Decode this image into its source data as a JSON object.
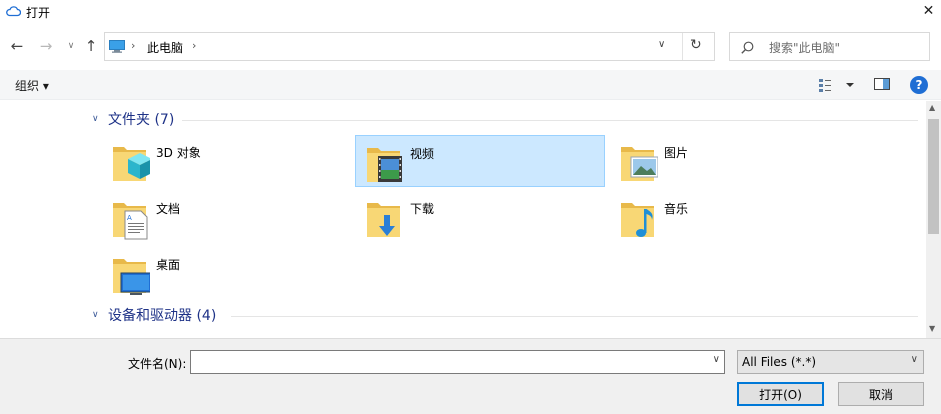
{
  "window": {
    "title": "打开",
    "close_glyph": "✕"
  },
  "nav": {
    "back": "←",
    "forward": "→",
    "recent": "∨",
    "up": "↑"
  },
  "address": {
    "sep": "›",
    "crumb": "此电脑",
    "dropdown": "∨",
    "refresh": "↻"
  },
  "search": {
    "placeholder": "搜索\"此电脑\""
  },
  "toolbar": {
    "organize_label": "组织 ▾",
    "help_label": "?"
  },
  "folders_group": {
    "label": "文件夹 (7)",
    "chevron": "∨",
    "items": [
      {
        "name": "3D 对象",
        "icon": "3d-objects-icon"
      },
      {
        "name": "视频",
        "icon": "videos-icon",
        "selected": true
      },
      {
        "name": "图片",
        "icon": "pictures-icon"
      },
      {
        "name": "文档",
        "icon": "documents-icon"
      },
      {
        "name": "下载",
        "icon": "downloads-icon"
      },
      {
        "name": "音乐",
        "icon": "music-icon"
      },
      {
        "name": "桌面",
        "icon": "desktop-icon"
      }
    ]
  },
  "drives_group": {
    "label": "设备和驱动器 (4)",
    "chevron": "∨"
  },
  "bottom": {
    "filename_label": "文件名(N):",
    "filename_value": "",
    "filter_value": "All Files (*.*)",
    "open_label": "打开(O)",
    "cancel_label": "取消",
    "dropdown": "∨"
  },
  "colors": {
    "accent": "#0078d7",
    "selection": "#cce8ff",
    "group_header": "#1e3287",
    "folder": "#f8d775"
  }
}
